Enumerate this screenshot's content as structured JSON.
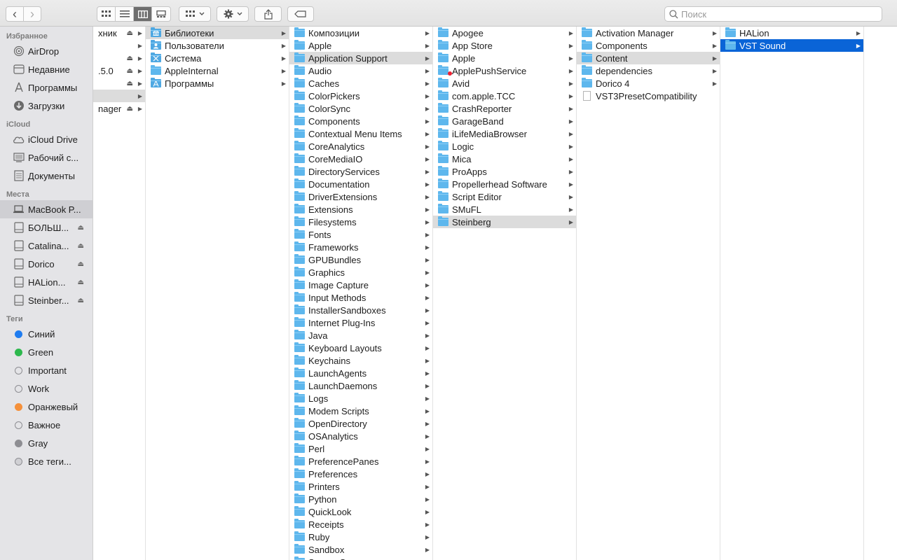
{
  "toolbar": {
    "back_glyph": "‹",
    "forward_glyph": "›",
    "search_placeholder": "Поиск"
  },
  "sidebar": {
    "favorites_header": "Избранное",
    "favorites": [
      {
        "label": "AirDrop",
        "icon": "airdrop-icon"
      },
      {
        "label": "Недавние",
        "icon": "clock-icon"
      },
      {
        "label": "Программы",
        "icon": "apps-icon"
      },
      {
        "label": "Загрузки",
        "icon": "download-icon"
      }
    ],
    "icloud_header": "iCloud",
    "icloud": [
      {
        "label": "iCloud Drive",
        "icon": "cloud-icon"
      },
      {
        "label": "Рабочий с...",
        "icon": "desktop-icon"
      },
      {
        "label": "Документы",
        "icon": "document-icon"
      }
    ],
    "places_header": "Места",
    "places": [
      {
        "label": "MacBook P...",
        "icon": "laptop-icon",
        "eject": false,
        "selected": true
      },
      {
        "label": "БОЛЬШ...",
        "icon": "disk-icon",
        "eject": true
      },
      {
        "label": "Catalina...",
        "icon": "disk-icon",
        "eject": true
      },
      {
        "label": "Dorico",
        "icon": "disk-icon",
        "eject": true
      },
      {
        "label": "HALion...",
        "icon": "disk-icon",
        "eject": true
      },
      {
        "label": "Steinber...",
        "icon": "disk-icon",
        "eject": true
      }
    ],
    "tags_header": "Теги",
    "tags": [
      {
        "label": "Синий",
        "color": "#1f7cf0"
      },
      {
        "label": "Green",
        "color": "#2db84d"
      },
      {
        "label": "Important",
        "color": "outline"
      },
      {
        "label": "Work",
        "color": "outline"
      },
      {
        "label": "Оранжевый",
        "color": "#f5903a"
      },
      {
        "label": "Важное",
        "color": "outline"
      },
      {
        "label": "Gray",
        "color": "#8e8e93"
      },
      {
        "label": "Все теги...",
        "color": "multi"
      }
    ]
  },
  "col0": [
    {
      "label": "хник",
      "eject": true
    },
    {
      "label": "",
      "eject": false
    },
    {
      "label": "",
      "eject": true
    },
    {
      "label": ".5.0",
      "eject": true
    },
    {
      "label": "",
      "eject": true
    },
    {
      "label": "",
      "eject": false,
      "selected": true
    },
    {
      "label": "nager",
      "eject": true
    }
  ],
  "col1": [
    {
      "label": "Библиотеки",
      "icon": "library",
      "selected": true
    },
    {
      "label": "Пользователи",
      "icon": "users"
    },
    {
      "label": "Система",
      "icon": "system"
    },
    {
      "label": "AppleInternal",
      "icon": "folder"
    },
    {
      "label": "Программы",
      "icon": "apps"
    }
  ],
  "col2": [
    {
      "label": "Композиции"
    },
    {
      "label": "Apple"
    },
    {
      "label": "Application Support",
      "selected": true
    },
    {
      "label": "Audio"
    },
    {
      "label": "Caches"
    },
    {
      "label": "ColorPickers"
    },
    {
      "label": "ColorSync"
    },
    {
      "label": "Components"
    },
    {
      "label": "Contextual Menu Items"
    },
    {
      "label": "CoreAnalytics"
    },
    {
      "label": "CoreMediaIO"
    },
    {
      "label": "DirectoryServices"
    },
    {
      "label": "Documentation"
    },
    {
      "label": "DriverExtensions"
    },
    {
      "label": "Extensions"
    },
    {
      "label": "Filesystems"
    },
    {
      "label": "Fonts"
    },
    {
      "label": "Frameworks"
    },
    {
      "label": "GPUBundles"
    },
    {
      "label": "Graphics"
    },
    {
      "label": "Image Capture"
    },
    {
      "label": "Input Methods"
    },
    {
      "label": "InstallerSandboxes"
    },
    {
      "label": "Internet Plug-Ins"
    },
    {
      "label": "Java"
    },
    {
      "label": "Keyboard Layouts"
    },
    {
      "label": "Keychains"
    },
    {
      "label": "LaunchAgents"
    },
    {
      "label": "LaunchDaemons"
    },
    {
      "label": "Logs"
    },
    {
      "label": "Modem Scripts"
    },
    {
      "label": "OpenDirectory"
    },
    {
      "label": "OSAnalytics"
    },
    {
      "label": "Perl"
    },
    {
      "label": "PreferencePanes"
    },
    {
      "label": "Preferences"
    },
    {
      "label": "Printers"
    },
    {
      "label": "Python"
    },
    {
      "label": "QuickLook"
    },
    {
      "label": "Receipts"
    },
    {
      "label": "Ruby"
    },
    {
      "label": "Sandbox"
    },
    {
      "label": "Screen Savers"
    }
  ],
  "col3": [
    {
      "label": "Apogee"
    },
    {
      "label": "App Store"
    },
    {
      "label": "Apple"
    },
    {
      "label": "ApplePushService",
      "badge": true
    },
    {
      "label": "Avid"
    },
    {
      "label": "com.apple.TCC"
    },
    {
      "label": "CrashReporter"
    },
    {
      "label": "GarageBand"
    },
    {
      "label": "iLifeMediaBrowser"
    },
    {
      "label": "Logic"
    },
    {
      "label": "Mica"
    },
    {
      "label": "ProApps"
    },
    {
      "label": "Propellerhead Software"
    },
    {
      "label": "Script Editor"
    },
    {
      "label": "SMuFL"
    },
    {
      "label": "Steinberg",
      "selected": true
    }
  ],
  "col4": [
    {
      "label": "Activation Manager"
    },
    {
      "label": "Components"
    },
    {
      "label": "Content",
      "selected": true
    },
    {
      "label": "dependencies"
    },
    {
      "label": "Dorico 4"
    },
    {
      "label": "VST3PresetCompatibility",
      "file": true
    }
  ],
  "col5": [
    {
      "label": "HALion"
    },
    {
      "label": "VST Sound",
      "selected": true
    }
  ]
}
